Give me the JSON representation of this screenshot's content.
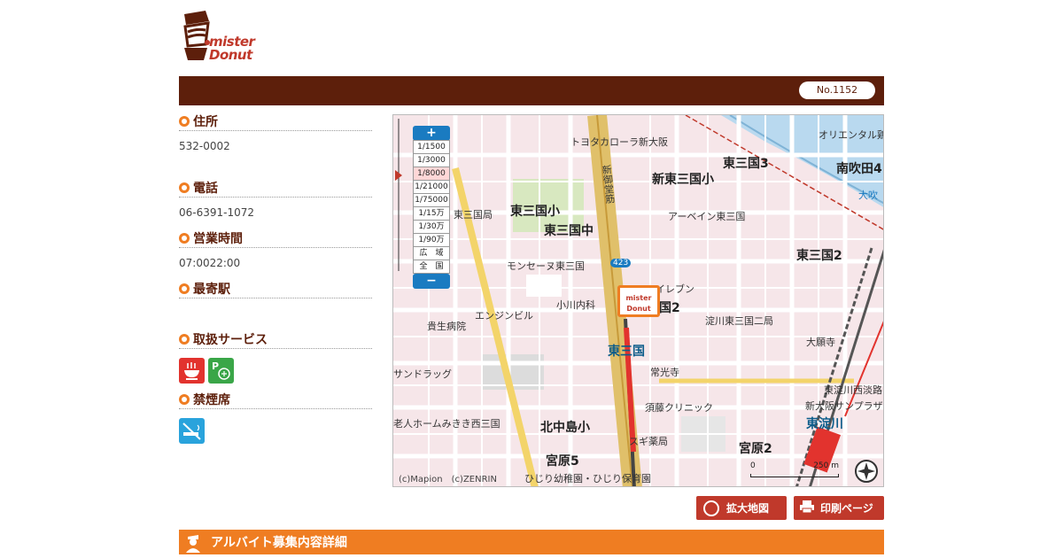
{
  "brand": {
    "logo_line1": "mister",
    "logo_line2": "Donut"
  },
  "header": {
    "store_number": "No.1152"
  },
  "info": {
    "address_label": "住所",
    "address_value": "532-0002",
    "phone_label": "電話",
    "phone_value": "06-6391-1072",
    "hours_label": "営業時間",
    "hours_value": "07:0022:00",
    "station_label": "最寄駅",
    "station_value": "",
    "services_label": "取扱サービス",
    "nonsmoking_label": "禁煙席"
  },
  "map": {
    "zoom_in": "+",
    "zoom_out": "−",
    "scales": [
      "1/1500",
      "1/3000",
      "1/8000",
      "1/21000",
      "1/75000",
      "1/15万",
      "1/30万",
      "1/90万",
      "広　域",
      "全　国"
    ],
    "selected_scale": "1/8000",
    "labels": {
      "higashimikuni3": "東三国3",
      "minamisuita4": "南吹田4",
      "higashimikuni2": "東三国2",
      "shinhigashimikuni_sho": "新東三国小",
      "higashimikuni_sho": "東三国小",
      "higashimikuni_chu": "東三国中",
      "higashimikuni_kyoku": "東三国局",
      "toyota": "トヨタカローラ新大阪",
      "aruban": "アーベイン東三国",
      "station_higashimikuni": "東三国",
      "station_higashiyodogawa": "東淀川",
      "kitanakajima_sho": "北中島小",
      "miyahara5": "宮原5",
      "miyahara2": "宮原2",
      "daikeiji": "大願寺",
      "jokoji": "常光寺",
      "sudo_clinic": "須藤クリニック",
      "sukiyakuhin": "スギ薬局",
      "hijiri": "ひじり幼稚園・ひじり保育園",
      "kishi_hosp": "貴生病院",
      "ogawa": "小川内科",
      "engin": "エンジンビル",
      "monseine": "モンセーヌ東三国",
      "yodogawa_post": "淀川東三国二局",
      "sun_drug": "サンドラッグ",
      "oriental": "オリエンタル鶏",
      "elevenmart": "イレブン",
      "roujin": "老人ホームみきき西三国",
      "highway": "新御堂筋",
      "kita_ku2": "国2",
      "shin_osaka_sun": "新大阪サンプラザ",
      "higashiyodogawa_nishiawaji": "東淀川西淡路",
      "national_road": "423",
      "daiichi": "大吹"
    },
    "copyright": "(c)Mapion　(c)ZENRIN",
    "scale_label": "250 m",
    "scale_zero": "0",
    "shop_marker_line1": "mister",
    "shop_marker_line2": "Donut"
  },
  "actions": {
    "enlarge_map": "拡大地図",
    "print_page": "印刷ページ"
  },
  "recruit": {
    "title": "アルバイト募集内容詳細"
  },
  "colors": {
    "brand_brown": "#5d1f0b",
    "brand_orange": "#ef7d22",
    "button_red": "#c0392b",
    "map_blue": "#1a7bc1"
  }
}
